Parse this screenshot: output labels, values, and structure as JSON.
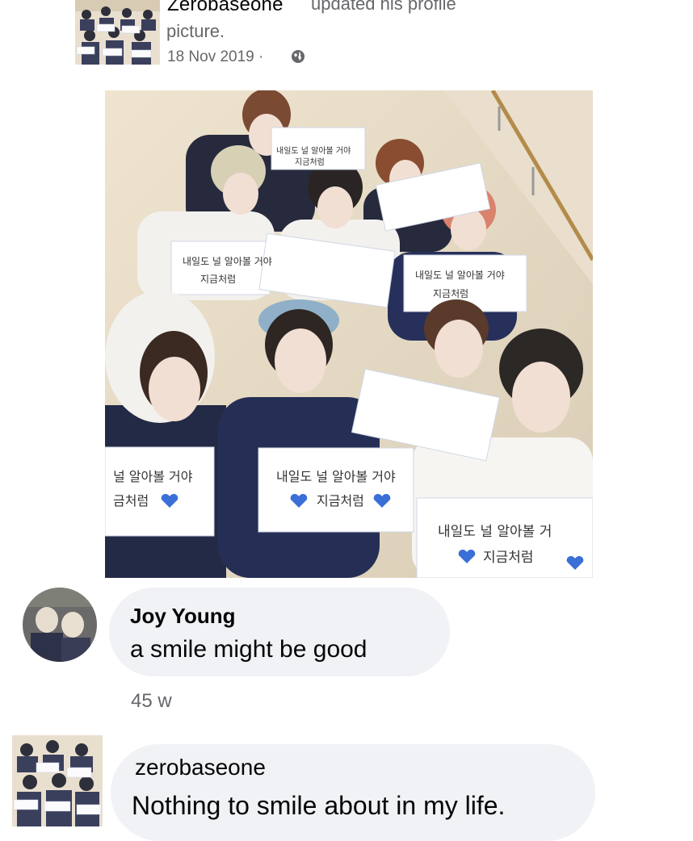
{
  "post": {
    "author": "Zerobaseone",
    "action": "updated his profile",
    "action_cont": "picture.",
    "date": "18 Nov 2019 · ",
    "privacy_icon": "globe-icon"
  },
  "photo": {
    "sign_line1": "내일도 널 알아볼 거야",
    "sign_line2": "지금처럼",
    "sign_left_line1": "널 알아볼 거야",
    "sign_left_line2": "금처럼",
    "sign_right_line1": "내일도 널 알아볼 거",
    "sign_right_line2": "지금처럼"
  },
  "comments": [
    {
      "author": "Joy Young",
      "text": "a smile might be good",
      "time": "45 w"
    },
    {
      "author": "zerobaseone",
      "text": "Nothing to smile about in my life."
    }
  ],
  "colors": {
    "heart": "#3b6fd8",
    "bubble": "#f0f2f5",
    "meta": "#65676b"
  }
}
